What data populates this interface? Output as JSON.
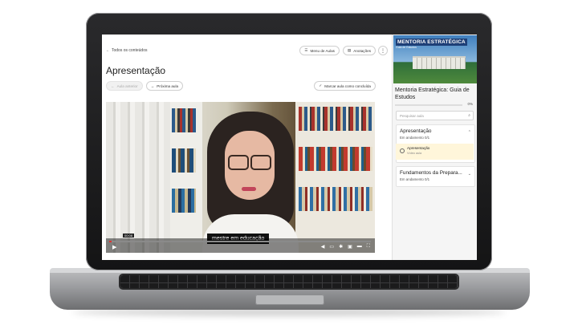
{
  "nav": {
    "back_label": "Todos os conteúdos",
    "back_icon": "arrow-left-icon"
  },
  "toolbar": {
    "menu_label": "Menu de Aulas",
    "notes_label": "Anotações",
    "more_icon": "kebab-icon"
  },
  "lesson": {
    "title": "Apresentação",
    "prev_label": "Aula anterior",
    "next_label": "Próxima aula",
    "complete_label": "Marcar aula como concluída"
  },
  "video": {
    "caption": "mestre em educação",
    "current_time": "00:08",
    "progress": 0.01
  },
  "sidebar": {
    "thumb_title": "MENTORIA ESTRATÉGICA",
    "thumb_subtitle": "Guia de Estudos",
    "course_title": "Mentoria Estratégica: Guia de Estudos",
    "progress_pct": "0%",
    "search_placeholder": "Pesquisar aula",
    "modules": [
      {
        "title": "Apresentação",
        "status": "Em andamento 0/1",
        "lessons": [
          {
            "title": "Apresentação",
            "type": "Vídeo aula"
          }
        ]
      },
      {
        "title": "Fundamentos da Prepara...",
        "status": "Em andamento 0/1"
      }
    ]
  },
  "colors": {
    "accent_yellow": "#fff6da",
    "thumb_title_bg": "#1e3f77",
    "progress_red": "#e03131"
  }
}
